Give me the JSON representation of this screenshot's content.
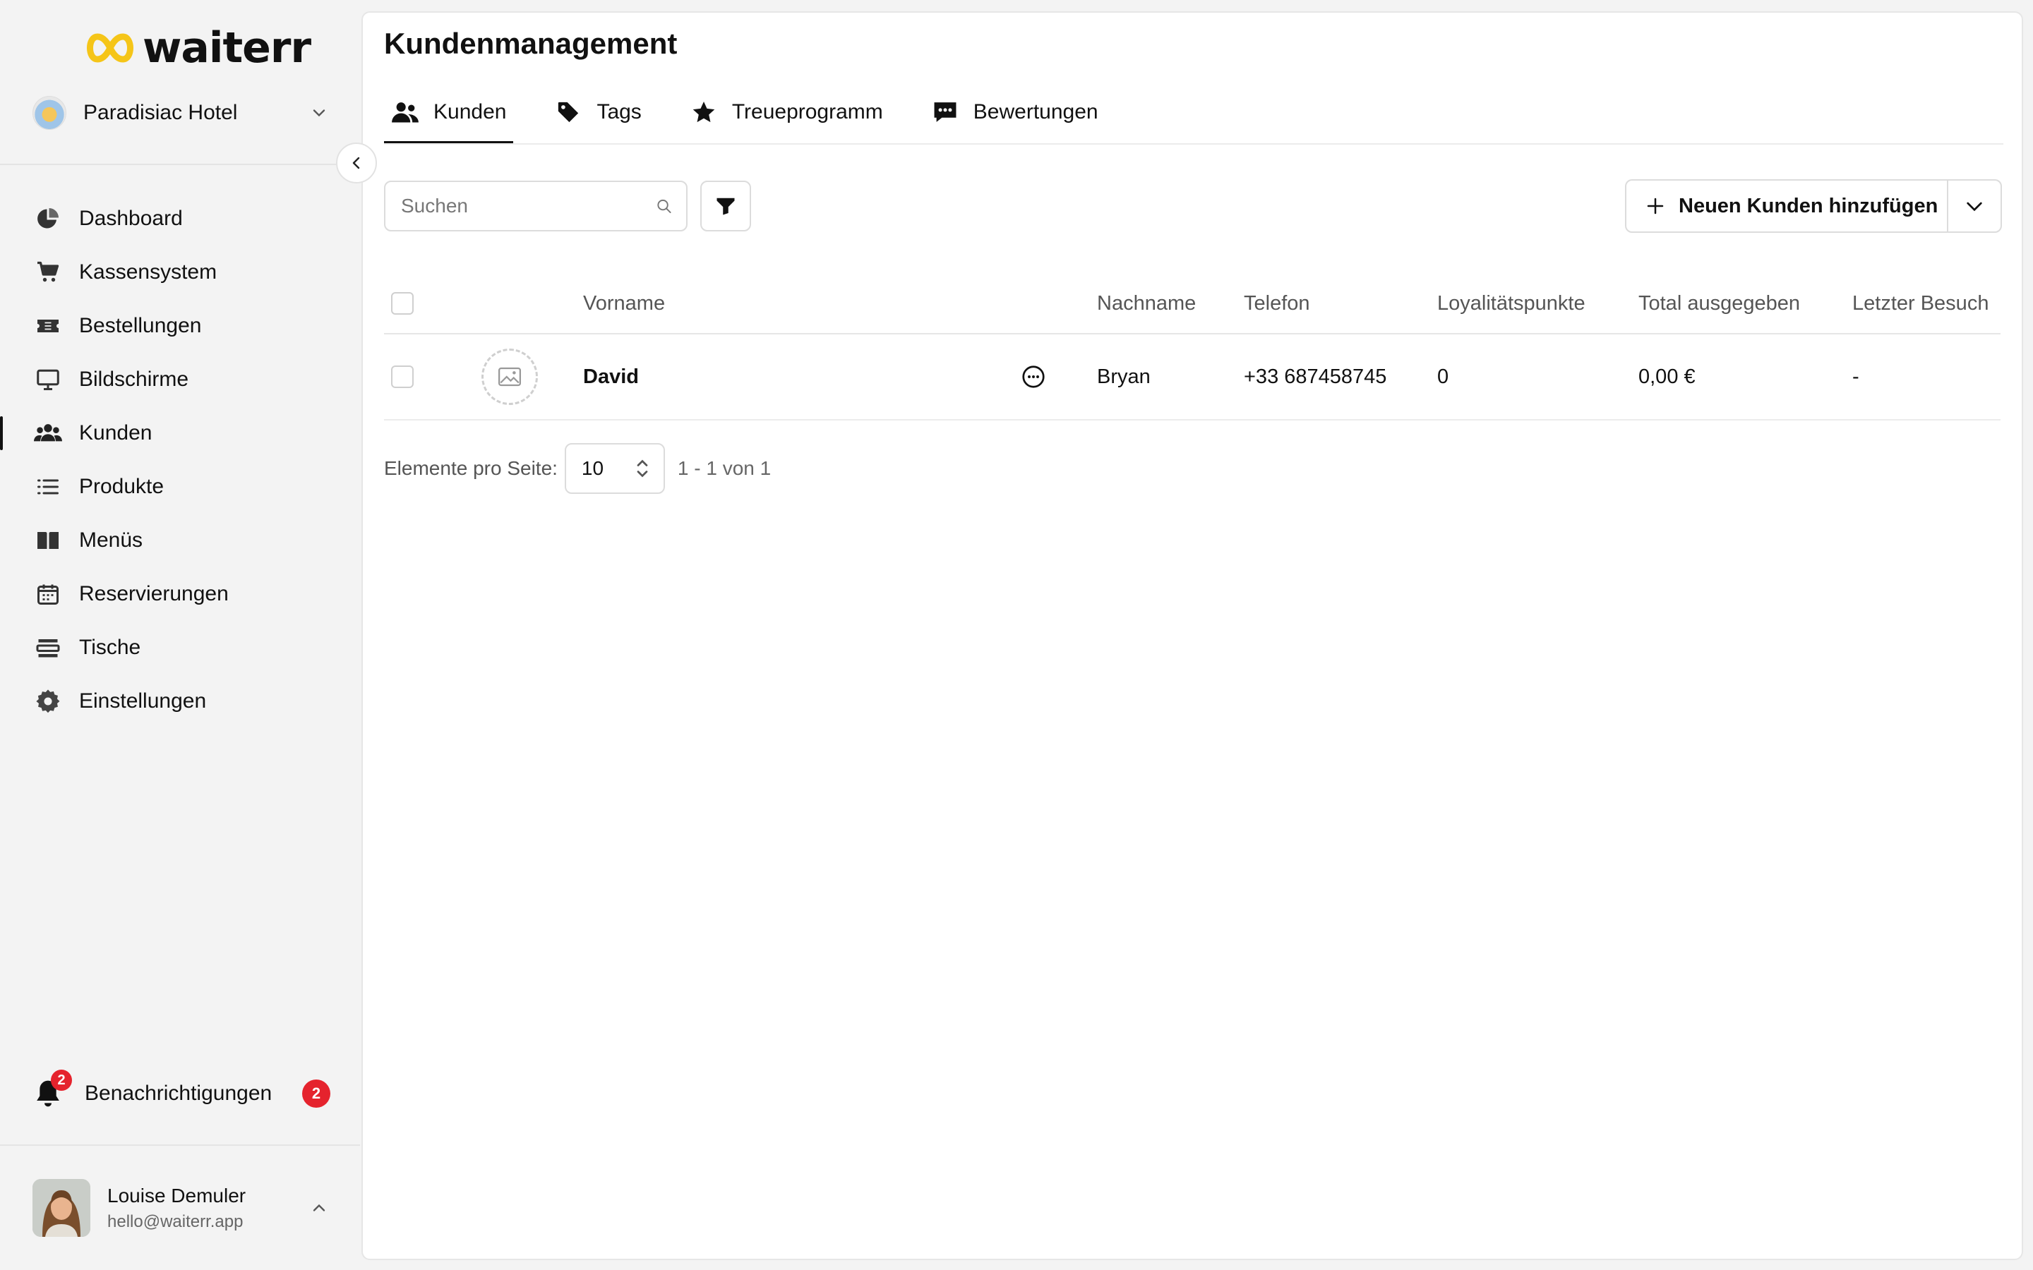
{
  "brand": {
    "name": "waiterr",
    "accent": "#f5c518"
  },
  "sidebar": {
    "venue": {
      "name": "Paradisiac Hotel"
    },
    "items": [
      {
        "label": "Dashboard",
        "icon": "pie-chart-icon"
      },
      {
        "label": "Kassensystem",
        "icon": "cart-icon"
      },
      {
        "label": "Bestellungen",
        "icon": "ticket-icon"
      },
      {
        "label": "Bildschirme",
        "icon": "monitor-icon"
      },
      {
        "label": "Kunden",
        "icon": "users-icon",
        "active": true
      },
      {
        "label": "Produkte",
        "icon": "list-icon"
      },
      {
        "label": "Menüs",
        "icon": "book-icon"
      },
      {
        "label": "Reservierungen",
        "icon": "calendar-icon"
      },
      {
        "label": "Tische",
        "icon": "table-icon"
      },
      {
        "label": "Einstellungen",
        "icon": "gear-icon"
      }
    ],
    "notifications": {
      "label": "Benachrichtigungen",
      "count": "2"
    },
    "user": {
      "name": "Louise Demuler",
      "email": "hello@waiterr.app"
    }
  },
  "main": {
    "title": "Kundenmanagement",
    "tabs": [
      {
        "label": "Kunden",
        "icon": "users-icon",
        "active": true
      },
      {
        "label": "Tags",
        "icon": "tag-icon"
      },
      {
        "label": "Treueprogramm",
        "icon": "star-icon"
      },
      {
        "label": "Bewertungen",
        "icon": "review-icon"
      }
    ],
    "search": {
      "placeholder": "Suchen",
      "value": ""
    },
    "add_button": {
      "label": "Neuen Kunden hinzufügen"
    },
    "table": {
      "columns": [
        "Vorname",
        "Nachname",
        "Telefon",
        "Loyalitätspunkte",
        "Total ausgegeben",
        "Letzter Besuch"
      ],
      "rows": [
        {
          "vorname": "David",
          "nachname": "Bryan",
          "telefon": "+33 687458745",
          "punkte": "0",
          "total": "0,00 €",
          "letzter_besuch": "-"
        }
      ]
    },
    "pagination": {
      "label": "Elemente pro Seite:",
      "per_page": "10",
      "range": "1 - 1 von 1"
    }
  },
  "colors": {
    "badge": "#e5232d",
    "text": "#111111",
    "muted": "#555555",
    "border": "#dcdcdc"
  }
}
